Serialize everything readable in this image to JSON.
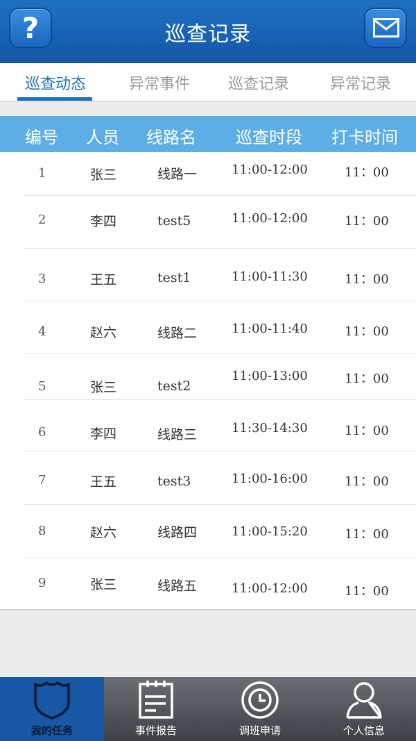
{
  "header": {
    "title": "巡查记录",
    "help_icon": "question-icon",
    "mail_icon": "mail-icon"
  },
  "tabs": [
    {
      "label": "巡查动态",
      "active": true
    },
    {
      "label": "异常事件",
      "active": false
    },
    {
      "label": "巡查记录",
      "active": false
    },
    {
      "label": "异常记录",
      "active": false
    }
  ],
  "table": {
    "columns": [
      "编号",
      "人员",
      "线路名",
      "巡查时段",
      "打卡时间"
    ],
    "rows": [
      {
        "no": "1",
        "person": "张三",
        "route": "线路一",
        "period": "11:00-12:00",
        "clock": "11：00"
      },
      {
        "no": "2",
        "person": "李四",
        "route": "test5",
        "period": "11:00-12:00",
        "clock": "11：00"
      },
      {
        "no": "3",
        "person": "王五",
        "route": "test1",
        "period": "11:00-11:30",
        "clock": "11：00"
      },
      {
        "no": "4",
        "person": "赵六",
        "route": "线路二",
        "period": "11:00-11:40",
        "clock": "11：00"
      },
      {
        "no": "5",
        "person": "张三",
        "route": "test2",
        "period": "11:00-13:00",
        "clock": "11：00"
      },
      {
        "no": "6",
        "person": "李四",
        "route": "线路三",
        "period": "11:30-14:30",
        "clock": "11：00"
      },
      {
        "no": "7",
        "person": "王五",
        "route": "test3",
        "period": "11:00-16:00",
        "clock": "11：00"
      },
      {
        "no": "8",
        "person": "赵六",
        "route": "线路四",
        "period": "11:00-15:20",
        "clock": "11：00"
      },
      {
        "no": "9",
        "person": "张三",
        "route": "线路五",
        "period": "11:00-12:00",
        "clock": "11：00"
      }
    ]
  },
  "bottom_nav": [
    {
      "label": "我的任务",
      "icon": "shield-icon",
      "active": true
    },
    {
      "label": "事件报告",
      "icon": "document-icon",
      "active": false
    },
    {
      "label": "调班申请",
      "icon": "clock-icon",
      "active": false
    },
    {
      "label": "个人信息",
      "icon": "person-icon",
      "active": false
    }
  ],
  "colors": {
    "header": "#1e6fc2",
    "table_header": "#5eaee6",
    "nav_active": "#1657a6",
    "nav_bg": "#55585e"
  }
}
